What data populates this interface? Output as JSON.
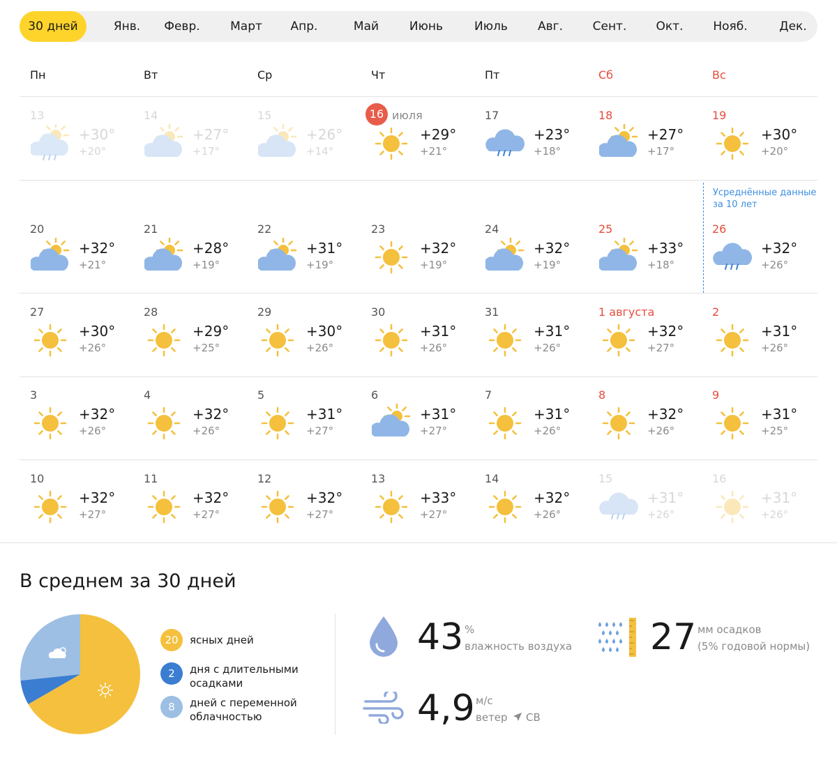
{
  "tabs": [
    {
      "label": "30 дней",
      "active": true
    },
    {
      "label": "Янв."
    },
    {
      "label": "Февр."
    },
    {
      "label": "Март"
    },
    {
      "label": "Апр."
    },
    {
      "label": "Май"
    },
    {
      "label": "Июнь"
    },
    {
      "label": "Июль"
    },
    {
      "label": "Авг."
    },
    {
      "label": "Сент."
    },
    {
      "label": "Окт."
    },
    {
      "label": "Нояб."
    },
    {
      "label": "Дек."
    }
  ],
  "weekdays": [
    "Пн",
    "Вт",
    "Ср",
    "Чт",
    "Пт",
    "Сб",
    "Вс"
  ],
  "today": {
    "day": "16",
    "month": "июля"
  },
  "averaged_note": "Усреднённые данные за 10 лет",
  "weeks": [
    [
      {
        "date": "13",
        "hi": "+30°",
        "lo": "+20°",
        "icon": "partly-cloudy-rain",
        "faded": true
      },
      {
        "date": "14",
        "hi": "+27°",
        "lo": "+17°",
        "icon": "partly-cloudy",
        "faded": true
      },
      {
        "date": "15",
        "hi": "+26°",
        "lo": "+14°",
        "icon": "partly-cloudy",
        "faded": true
      },
      {
        "date": "16",
        "hi": "+29°",
        "lo": "+21°",
        "icon": "sun",
        "today": true
      },
      {
        "date": "17",
        "hi": "+23°",
        "lo": "+18°",
        "icon": "rain"
      },
      {
        "date": "18",
        "hi": "+27°",
        "lo": "+17°",
        "icon": "partly-cloudy",
        "weekend": true
      },
      {
        "date": "19",
        "hi": "+30°",
        "lo": "+20°",
        "icon": "sun",
        "weekend": true
      }
    ],
    [
      {
        "date": "20",
        "hi": "+32°",
        "lo": "+21°",
        "icon": "partly-cloudy"
      },
      {
        "date": "21",
        "hi": "+28°",
        "lo": "+19°",
        "icon": "partly-cloudy"
      },
      {
        "date": "22",
        "hi": "+31°",
        "lo": "+19°",
        "icon": "partly-cloudy"
      },
      {
        "date": "23",
        "hi": "+32°",
        "lo": "+19°",
        "icon": "sun"
      },
      {
        "date": "24",
        "hi": "+32°",
        "lo": "+19°",
        "icon": "partly-cloudy"
      },
      {
        "date": "25",
        "hi": "+33°",
        "lo": "+18°",
        "icon": "partly-cloudy",
        "weekend": true
      },
      {
        "date": "26",
        "hi": "+32°",
        "lo": "+26°",
        "icon": "rain",
        "weekend": true
      }
    ],
    [
      {
        "date": "27",
        "hi": "+30°",
        "lo": "+26°",
        "icon": "sun"
      },
      {
        "date": "28",
        "hi": "+29°",
        "lo": "+25°",
        "icon": "sun"
      },
      {
        "date": "29",
        "hi": "+30°",
        "lo": "+26°",
        "icon": "sun"
      },
      {
        "date": "30",
        "hi": "+31°",
        "lo": "+26°",
        "icon": "sun"
      },
      {
        "date": "31",
        "hi": "+31°",
        "lo": "+26°",
        "icon": "sun"
      },
      {
        "date": "1 августа",
        "hi": "+32°",
        "lo": "+27°",
        "icon": "sun",
        "weekend": true
      },
      {
        "date": "2",
        "hi": "+31°",
        "lo": "+26°",
        "icon": "sun",
        "weekend": true
      }
    ],
    [
      {
        "date": "3",
        "hi": "+32°",
        "lo": "+26°",
        "icon": "sun"
      },
      {
        "date": "4",
        "hi": "+32°",
        "lo": "+26°",
        "icon": "sun"
      },
      {
        "date": "5",
        "hi": "+31°",
        "lo": "+27°",
        "icon": "sun"
      },
      {
        "date": "6",
        "hi": "+31°",
        "lo": "+27°",
        "icon": "partly-cloudy"
      },
      {
        "date": "7",
        "hi": "+31°",
        "lo": "+26°",
        "icon": "sun"
      },
      {
        "date": "8",
        "hi": "+32°",
        "lo": "+26°",
        "icon": "sun",
        "weekend": true
      },
      {
        "date": "9",
        "hi": "+31°",
        "lo": "+25°",
        "icon": "sun",
        "weekend": true
      }
    ],
    [
      {
        "date": "10",
        "hi": "+32°",
        "lo": "+27°",
        "icon": "sun"
      },
      {
        "date": "11",
        "hi": "+32°",
        "lo": "+27°",
        "icon": "sun"
      },
      {
        "date": "12",
        "hi": "+32°",
        "lo": "+27°",
        "icon": "sun"
      },
      {
        "date": "13",
        "hi": "+33°",
        "lo": "+27°",
        "icon": "sun"
      },
      {
        "date": "14",
        "hi": "+32°",
        "lo": "+26°",
        "icon": "sun"
      },
      {
        "date": "15",
        "hi": "+31°",
        "lo": "+26°",
        "icon": "rain",
        "faded": true,
        "weekend": true
      },
      {
        "date": "16",
        "hi": "+31°",
        "lo": "+26°",
        "icon": "sun",
        "faded": true,
        "weekend": true
      }
    ]
  ],
  "summary": {
    "title": "В среднем за 30 дней",
    "legend": [
      {
        "count": "20",
        "label": "ясных дней",
        "color": "#f4c03d"
      },
      {
        "count": "2",
        "label": "дня с длительными осадками",
        "color": "#3b7dd1"
      },
      {
        "count": "8",
        "label": "дней с переменной облачностью",
        "color": "#9dbfe3"
      }
    ],
    "humidity": {
      "value": "43",
      "unit": "%",
      "label": "влажность воздуха"
    },
    "precip": {
      "value": "27",
      "unit": "мм осадков",
      "label": "(5% годовой нормы)"
    },
    "wind": {
      "value": "4,9",
      "unit": "м/с",
      "label": "ветер",
      "direction": "СВ"
    }
  },
  "colors": {
    "sun": "#f4c03d",
    "cloud": "#8fb6e6",
    "weekend": "#e74c3c",
    "accent": "#fed42b"
  }
}
